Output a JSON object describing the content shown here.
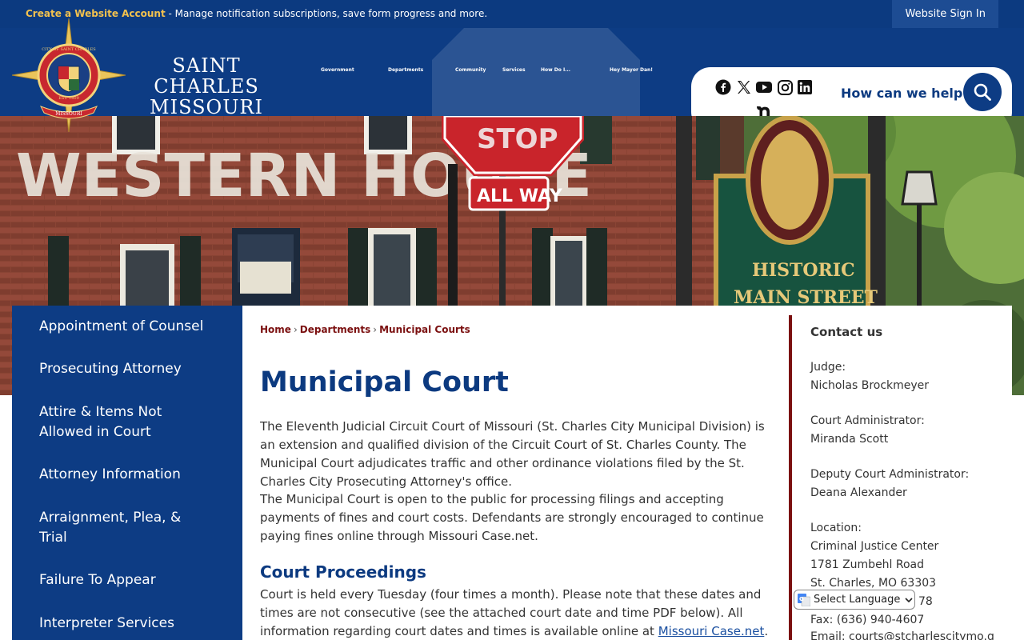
{
  "topbar": {
    "account_link": "Create a Website Account",
    "message": " - Manage notification subscriptions, save form progress and more.",
    "signin": "Website Sign In"
  },
  "brand": {
    "line1": "SAINT CHARLES",
    "line2": "MISSOURI"
  },
  "seal": {
    "ring_text": "CITY OF SAINT CHARLES",
    "est": "EST. 1809",
    "banner": "MISSOURI"
  },
  "nav": [
    "Government",
    "Departments",
    "Community",
    "Services",
    "How Do I...",
    "Hey Mayor Dan!"
  ],
  "search": {
    "placeholder": "How can we help you?"
  },
  "social": [
    "facebook-icon",
    "x-icon",
    "youtube-icon",
    "instagram-icon",
    "linkedin-icon",
    "nextdoor-icon"
  ],
  "hero": {
    "building_sign": "WESTERN HOUSE",
    "sign_all_way": "ALL WAY",
    "sign_historic": "HISTORIC",
    "sign_main": "MAIN STREET",
    "sign_stop": "STOP"
  },
  "sidebar": {
    "items": [
      "Appointment of Counsel",
      "Prosecuting Attorney",
      "Attire & Items Not Allowed in Court",
      "Attorney Information",
      "Arraignment, Plea, & Trial",
      "Failure To Appear",
      "Interpreter Services"
    ]
  },
  "breadcrumb": {
    "home": "Home",
    "departments": "Departments",
    "current": "Municipal Courts"
  },
  "main": {
    "title": "Municipal Court",
    "para1": "The Eleventh Judicial Circuit Court of Missouri (St. Charles City Municipal Division) is an extension and qualified division of the Circuit Court of St. Charles County. The Municipal Court adjudicates traffic and other ordinance violations filed by the St. Charles City Prosecuting Attorney's office.",
    "para2": "The Municipal Court is open to the public for processing filings and accepting payments of fines and court costs. Defendants are strongly encouraged to continue paying fines online through Missouri Case.net.",
    "section_title": "Court Proceedings",
    "para3_text": "Court is held every Tuesday (four times a month). Please note that these dates and times are not consecutive (see the attached court date and time PDF below). All information regarding court dates and times is available online at ",
    "para3_link": "Missouri Case.net",
    "para3_end": "."
  },
  "contact": {
    "heading": "Contact us",
    "judge_label": "Judge:",
    "judge": "Nicholas Brockmeyer",
    "admin_label": "Court Administrator:",
    "admin": "Miranda Scott",
    "deputy_label": "Deputy Court Administrator:",
    "deputy": "Deana Alexander",
    "location_label": "Location:",
    "location1": "Criminal Justice Center",
    "location2": "1781 Zumbehl Road",
    "location3": "St. Charles, MO 63303",
    "phone_partial": "78",
    "fax": "Fax: (636) 940-4607",
    "email": "Email: courts@stcharlescitymo.g"
  },
  "translate": {
    "label": "Select Language",
    "behind": "Translate"
  },
  "colors": {
    "navy": "#0d3c84",
    "maroon": "#7b1010",
    "gold": "#f2c14e"
  }
}
